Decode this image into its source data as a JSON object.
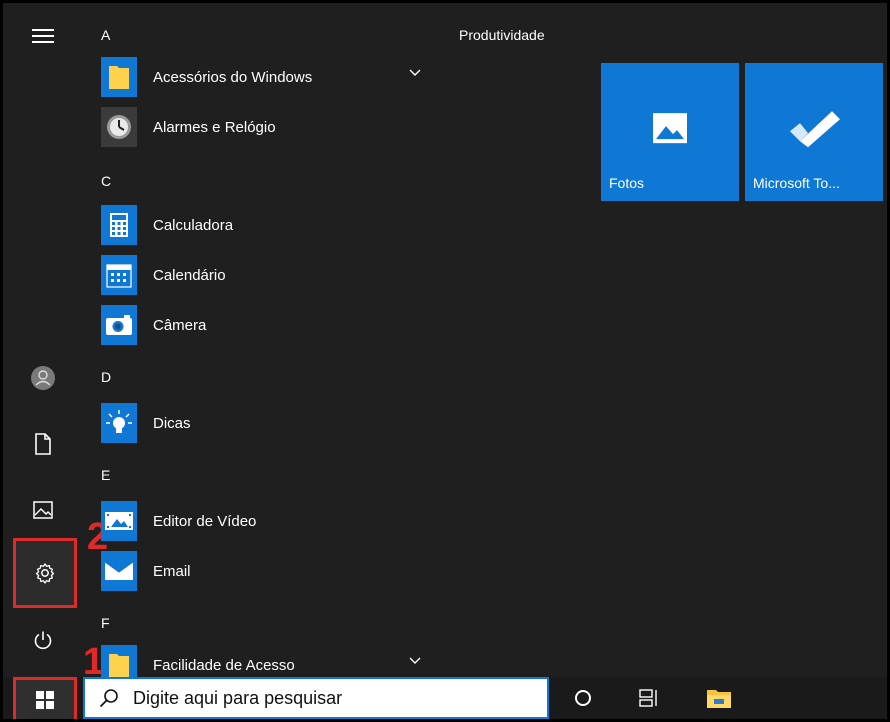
{
  "tiles": {
    "group_title": "Produtividade",
    "items": [
      {
        "label": "Fotos",
        "icon": "photos-icon"
      },
      {
        "label": "Microsoft To...",
        "icon": "microsoft-todo-icon"
      }
    ]
  },
  "app_list": {
    "sections": [
      {
        "letter": "A"
      },
      {
        "letter": "C"
      },
      {
        "letter": "D"
      },
      {
        "letter": "E"
      },
      {
        "letter": "F"
      }
    ],
    "apps": [
      {
        "label": "Acessórios do Windows",
        "icon": "folder-icon",
        "expandable": true
      },
      {
        "label": "Alarmes e Relógio",
        "icon": "clock-icon"
      },
      {
        "label": "Calculadora",
        "icon": "calculator-icon"
      },
      {
        "label": "Calendário",
        "icon": "calendar-icon"
      },
      {
        "label": "Câmera",
        "icon": "camera-icon"
      },
      {
        "label": "Dicas",
        "icon": "lightbulb-icon"
      },
      {
        "label": "Editor de Vídeo",
        "icon": "video-editor-icon"
      },
      {
        "label": "Email",
        "icon": "mail-icon"
      },
      {
        "label": "Facilidade de Acesso",
        "icon": "folder-icon",
        "expandable": true
      }
    ]
  },
  "rail": {
    "items": [
      "hamburger-menu-icon",
      "user-icon",
      "document-icon",
      "pictures-icon",
      "settings-icon",
      "power-icon"
    ]
  },
  "annotations": {
    "step_1": "1",
    "step_2": "2",
    "color": "#e02a2a"
  },
  "taskbar": {
    "search_placeholder": "Digite aqui para pesquisar",
    "icons": [
      "windows-start-icon",
      "search-icon",
      "cortana-icon",
      "task-view-icon",
      "file-explorer-icon"
    ]
  },
  "colors": {
    "accent": "#0f78d4",
    "background": "#1f1f1f"
  }
}
